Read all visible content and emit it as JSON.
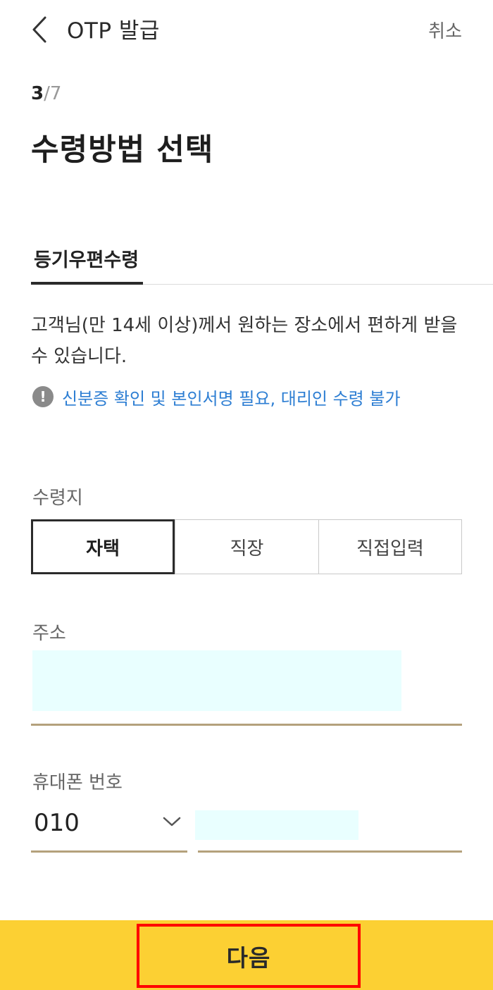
{
  "header": {
    "title": "OTP 발급",
    "cancel_label": "취소",
    "back_icon": "chevron-left-icon"
  },
  "step": {
    "current": "3",
    "separator": "/",
    "total": "7"
  },
  "page_title": "수령방법 선택",
  "tabs": [
    {
      "label": "등기우편수령",
      "active": true
    }
  ],
  "description": "고객님(만 14세 이상)께서 원하는 장소에서 편하게 받을 수 있습니다.",
  "notice": {
    "icon": "exclamation-circle-icon",
    "text": "신분증 확인 및 본인서명 필요, 대리인 수령 불가",
    "color": "#2d7ed3"
  },
  "location": {
    "label": "수령지",
    "options": [
      "자택",
      "직장",
      "직접입력"
    ],
    "selected": "자택"
  },
  "address": {
    "label": "주소",
    "value": ""
  },
  "phone": {
    "label": "휴대폰 번호",
    "prefix_value": "010",
    "number_value": "",
    "dropdown_icon": "chevron-down-icon"
  },
  "footer": {
    "next_label": "다음",
    "bar_color": "#fcd033",
    "highlight_color": "#ff0000"
  }
}
